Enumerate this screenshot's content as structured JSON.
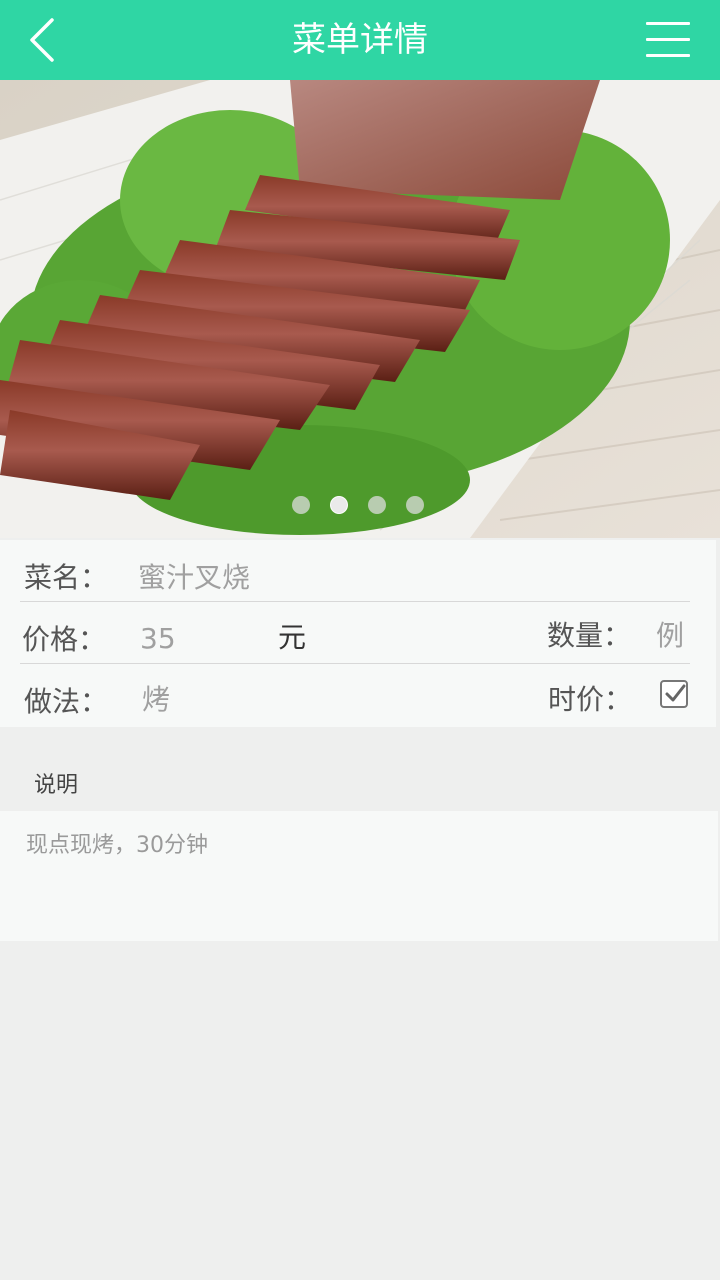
{
  "header": {
    "title": "菜单详情",
    "back_icon": "chevron-left-icon",
    "menu_icon": "hamburger-menu-icon",
    "color": "#2fd6a4"
  },
  "gallery": {
    "image": "char-siu-pork-photo",
    "slide_count": 4,
    "active_index": 1
  },
  "details": {
    "name_label": "菜名：",
    "name_value": "蜜汁叉烧",
    "price_label": "价格：",
    "price_value": "35",
    "price_unit": "元",
    "qty_label": "数量：",
    "qty_value": "例",
    "method_label": "做法：",
    "method_value": "烤",
    "market_price_label": "时价：",
    "market_price_checked": true
  },
  "description": {
    "heading": "说明",
    "text": "现点现烤，30分钟"
  }
}
